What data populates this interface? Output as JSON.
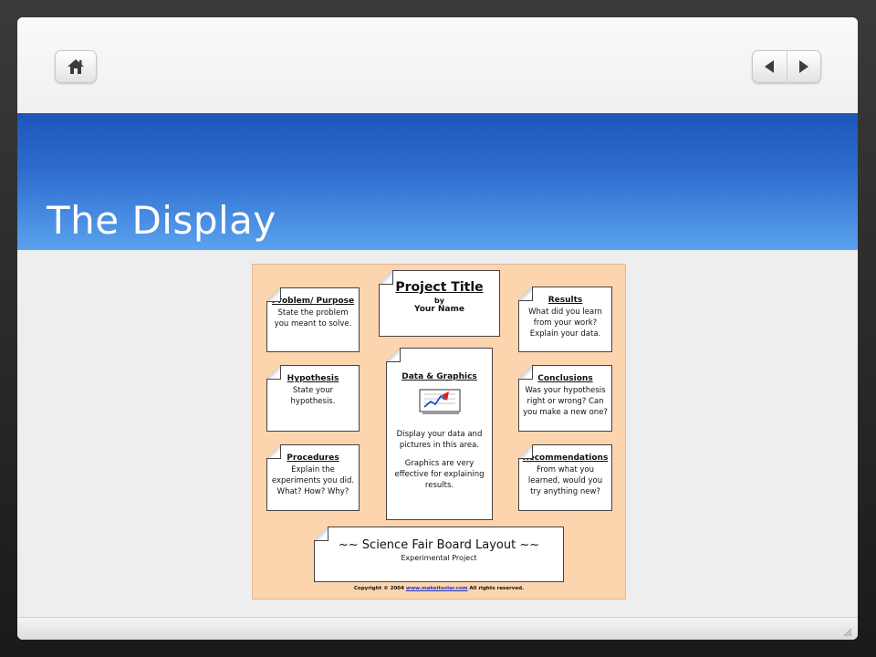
{
  "slide": {
    "title": "The Display"
  },
  "nav": {
    "home_icon": "home-icon",
    "prev_icon": "triangle-left-icon",
    "next_icon": "triangle-right-icon"
  },
  "poster": {
    "problem": {
      "heading": "Problem/ Purpose",
      "body": [
        "State the problem",
        "you meant to solve."
      ]
    },
    "project": {
      "title": "Project Title",
      "by": "by",
      "name": "Your Name"
    },
    "results": {
      "heading": "Results",
      "body": [
        "What did you learn",
        "from your work?",
        "Explain your data."
      ]
    },
    "hypothesis": {
      "heading": "Hypothesis",
      "body": [
        "State your",
        "hypothesis."
      ]
    },
    "data": {
      "heading": "Data & Graphics",
      "body1": [
        "Display your data and",
        "pictures in this area."
      ],
      "body2": [
        "Graphics are very",
        "effective for explaining",
        "results."
      ]
    },
    "conclusions": {
      "heading": "Conclusions",
      "body": [
        "Was your hypothesis",
        "right or wrong?  Can",
        "you make a new one?"
      ]
    },
    "procedures": {
      "heading": "Procedures",
      "body": [
        "Explain the",
        "experiments you did.",
        "What?  How?  Why?"
      ]
    },
    "recommendations": {
      "heading": "Recommendations",
      "body": [
        "From what you",
        "learned, would you",
        "try anything new?"
      ]
    },
    "footer": {
      "title": "~~ Science Fair Board Layout ~~",
      "subtitle": "Experimental Project"
    },
    "copyright": {
      "prefix": "Copyright  ©  2004",
      "link": "www.makeitsolar.com",
      "suffix": "All rights reserved."
    }
  },
  "colors": {
    "title_band_top": "#1d55b8",
    "title_band_bottom": "#5aa2ee",
    "poster_bg": "#fcd4ae"
  }
}
